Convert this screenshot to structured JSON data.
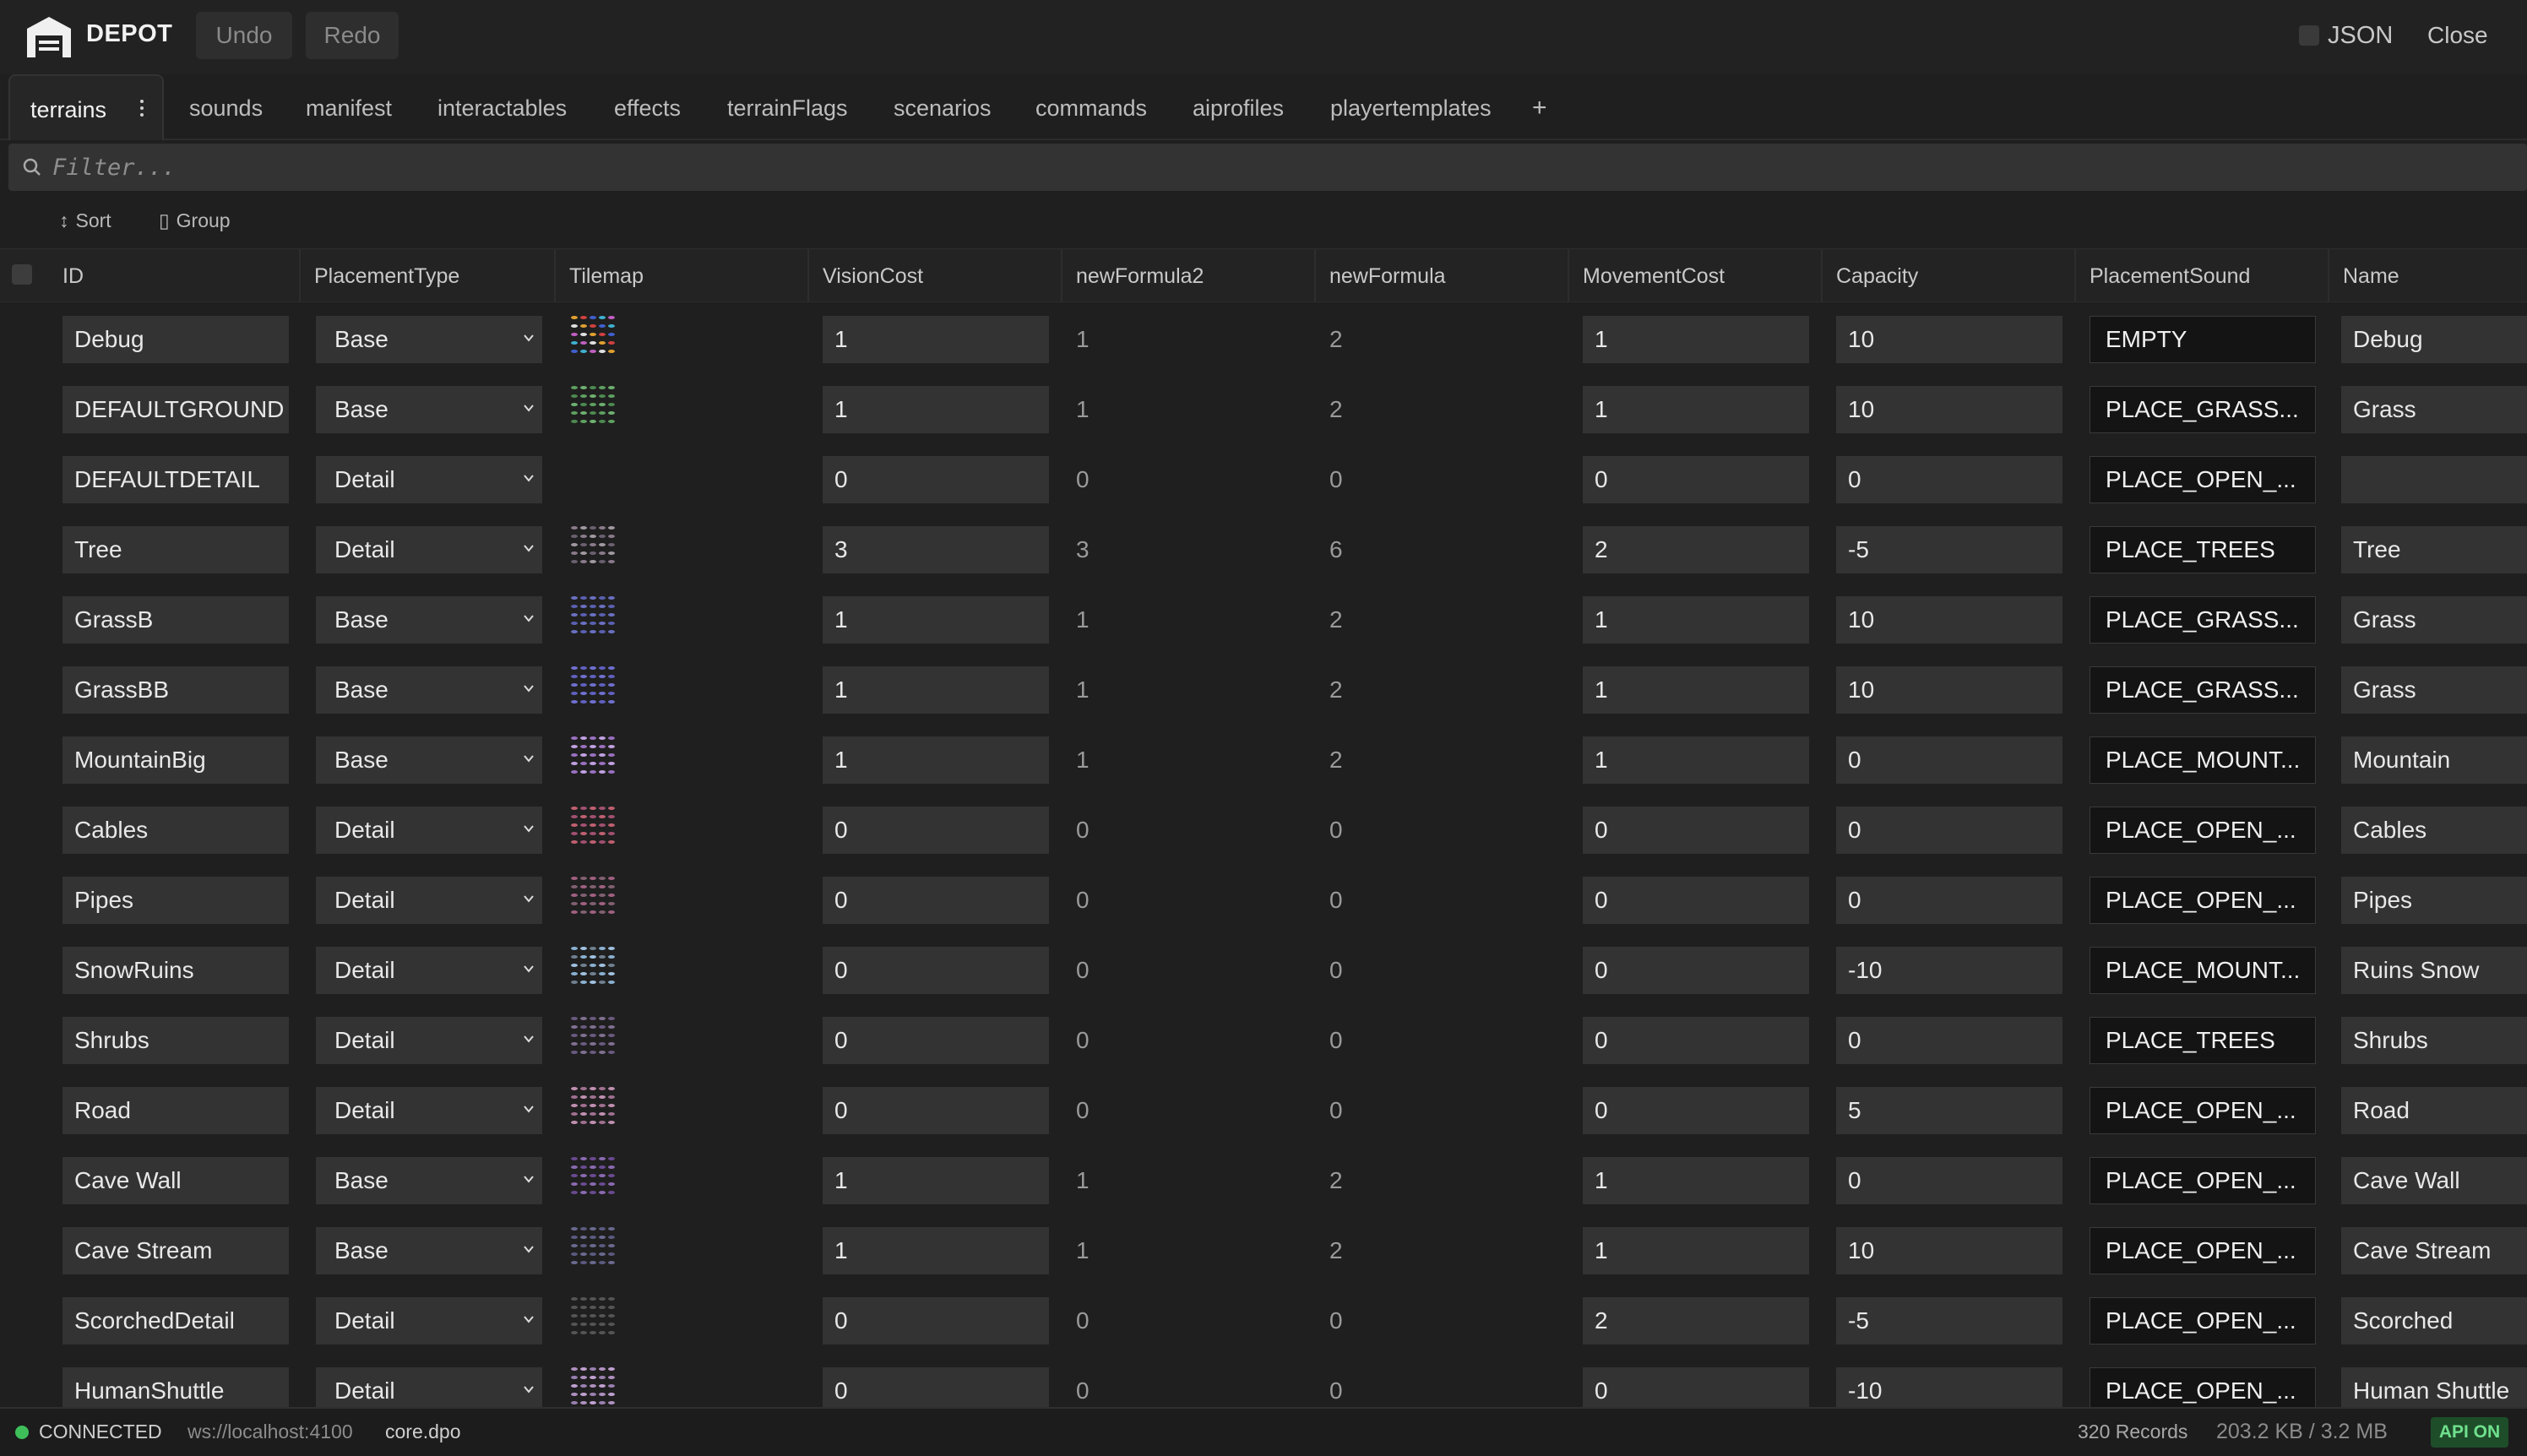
{
  "app": {
    "title": "DEPOT",
    "undo_label": "Undo",
    "redo_label": "Redo",
    "json_label": "JSON",
    "close_label": "Close",
    "icon": "garage-icon"
  },
  "tabs": [
    {
      "label": "terrains",
      "active": true
    },
    {
      "label": "sounds"
    },
    {
      "label": "manifest"
    },
    {
      "label": "interactables"
    },
    {
      "label": "effects"
    },
    {
      "label": "terrainFlags"
    },
    {
      "label": "scenarios"
    },
    {
      "label": "commands"
    },
    {
      "label": "aiprofiles"
    },
    {
      "label": "playertemplates"
    },
    {
      "label": "+"
    }
  ],
  "filter": {
    "placeholder": "Filter..."
  },
  "tools": {
    "sort_label": "Sort",
    "group_label": "Group"
  },
  "table": {
    "columns": [
      "ID",
      "PlacementType",
      "Tilemap",
      "VisionCost",
      "newFormula2",
      "newFormula",
      "MovementCost",
      "Capacity",
      "PlacementSound",
      "Name"
    ],
    "rows": [
      {
        "id": "Debug",
        "placement_type": "Base",
        "vision_cost": "1",
        "new_formula2": "1",
        "new_formula": "2",
        "movement_cost": "1",
        "capacity": "10",
        "placement_sound": "EMPTY",
        "name": "Debug"
      },
      {
        "id": "DEFAULTGROUND",
        "placement_type": "Base",
        "vision_cost": "1",
        "new_formula2": "1",
        "new_formula": "2",
        "movement_cost": "1",
        "capacity": "10",
        "placement_sound": "PLACE_GRASS...",
        "name": "Grass"
      },
      {
        "id": "DEFAULTDETAIL",
        "placement_type": "Detail",
        "vision_cost": "0",
        "new_formula2": "0",
        "new_formula": "0",
        "movement_cost": "0",
        "capacity": "0",
        "placement_sound": "PLACE_OPEN_...",
        "name": ""
      },
      {
        "id": "Tree",
        "placement_type": "Detail",
        "vision_cost": "3",
        "new_formula2": "3",
        "new_formula": "6",
        "movement_cost": "2",
        "capacity": "-5",
        "placement_sound": "PLACE_TREES",
        "name": "Tree"
      },
      {
        "id": "GrassB",
        "placement_type": "Base",
        "vision_cost": "1",
        "new_formula2": "1",
        "new_formula": "2",
        "movement_cost": "1",
        "capacity": "10",
        "placement_sound": "PLACE_GRASS...",
        "name": "Grass"
      },
      {
        "id": "GrassBB",
        "placement_type": "Base",
        "vision_cost": "1",
        "new_formula2": "1",
        "new_formula": "2",
        "movement_cost": "1",
        "capacity": "10",
        "placement_sound": "PLACE_GRASS...",
        "name": "Grass"
      },
      {
        "id": "MountainBig",
        "placement_type": "Base",
        "vision_cost": "1",
        "new_formula2": "1",
        "new_formula": "2",
        "movement_cost": "1",
        "capacity": "0",
        "placement_sound": "PLACE_MOUNT...",
        "name": "Mountain"
      },
      {
        "id": "Cables",
        "placement_type": "Detail",
        "vision_cost": "0",
        "new_formula2": "0",
        "new_formula": "0",
        "movement_cost": "0",
        "capacity": "0",
        "placement_sound": "PLACE_OPEN_...",
        "name": "Cables"
      },
      {
        "id": "Pipes",
        "placement_type": "Detail",
        "vision_cost": "0",
        "new_formula2": "0",
        "new_formula": "0",
        "movement_cost": "0",
        "capacity": "0",
        "placement_sound": "PLACE_OPEN_...",
        "name": "Pipes"
      },
      {
        "id": "SnowRuins",
        "placement_type": "Detail",
        "vision_cost": "0",
        "new_formula2": "0",
        "new_formula": "0",
        "movement_cost": "0",
        "capacity": "-10",
        "placement_sound": "PLACE_MOUNT...",
        "name": "Ruins Snow"
      },
      {
        "id": "Shrubs",
        "placement_type": "Detail",
        "vision_cost": "0",
        "new_formula2": "0",
        "new_formula": "0",
        "movement_cost": "0",
        "capacity": "0",
        "placement_sound": "PLACE_TREES",
        "name": "Shrubs"
      },
      {
        "id": "Road",
        "placement_type": "Detail",
        "vision_cost": "0",
        "new_formula2": "0",
        "new_formula": "0",
        "movement_cost": "0",
        "capacity": "5",
        "placement_sound": "PLACE_OPEN_...",
        "name": "Road"
      },
      {
        "id": "Cave Wall",
        "placement_type": "Base",
        "vision_cost": "1",
        "new_formula2": "1",
        "new_formula": "2",
        "movement_cost": "1",
        "capacity": "0",
        "placement_sound": "PLACE_OPEN_...",
        "name": "Cave Wall"
      },
      {
        "id": "Cave Stream",
        "placement_type": "Base",
        "vision_cost": "1",
        "new_formula2": "1",
        "new_formula": "2",
        "movement_cost": "1",
        "capacity": "10",
        "placement_sound": "PLACE_OPEN_...",
        "name": "Cave Stream"
      },
      {
        "id": "ScorchedDetail",
        "placement_type": "Detail",
        "vision_cost": "0",
        "new_formula2": "0",
        "new_formula": "0",
        "movement_cost": "2",
        "capacity": "-5",
        "placement_sound": "PLACE_OPEN_...",
        "name": "Scorched"
      },
      {
        "id": "HumanShuttle",
        "placement_type": "Detail",
        "vision_cost": "0",
        "new_formula2": "0",
        "new_formula": "0",
        "movement_cost": "0",
        "capacity": "-10",
        "placement_sound": "PLACE_OPEN_...",
        "name": "Human Shuttle"
      }
    ],
    "tilemap_palettes": [
      [
        "#e0a030",
        "#d04040",
        "#4060d0",
        "#40b0d0",
        "#c060c0",
        "#e0e0e0"
      ],
      [
        "#5fa060",
        "#6fb070",
        "#4c8a50"
      ],
      [],
      [
        "#8a7a8a",
        "#a09aa0",
        "#6a6070"
      ],
      [
        "#6a70c0",
        "#5a60b0"
      ],
      [
        "#7070d0",
        "#6060c0"
      ],
      [
        "#9a70c0",
        "#c0a0e0"
      ],
      [
        "#c06070",
        "#a05070"
      ],
      [
        "#a06080",
        "#806070"
      ],
      [
        "#8ab0d0",
        "#a0c0e0",
        "#708090"
      ],
      [
        "#6a5a80",
        "#807090"
      ],
      [
        "#c090b0",
        "#a07090"
      ],
      [
        "#6a4a90",
        "#8a6ab0"
      ],
      [
        "#6a6a90",
        "#5a5a80"
      ],
      [
        "#555555"
      ],
      [
        "#b090c0",
        "#c0a0d0",
        "#9a80b0"
      ]
    ]
  },
  "status": {
    "state": "CONNECTED",
    "url": "ws://localhost:4100",
    "file": "core.dpo",
    "records": "320 Records",
    "size": "203.2 KB / 3.2 MB",
    "api": "API ON"
  }
}
